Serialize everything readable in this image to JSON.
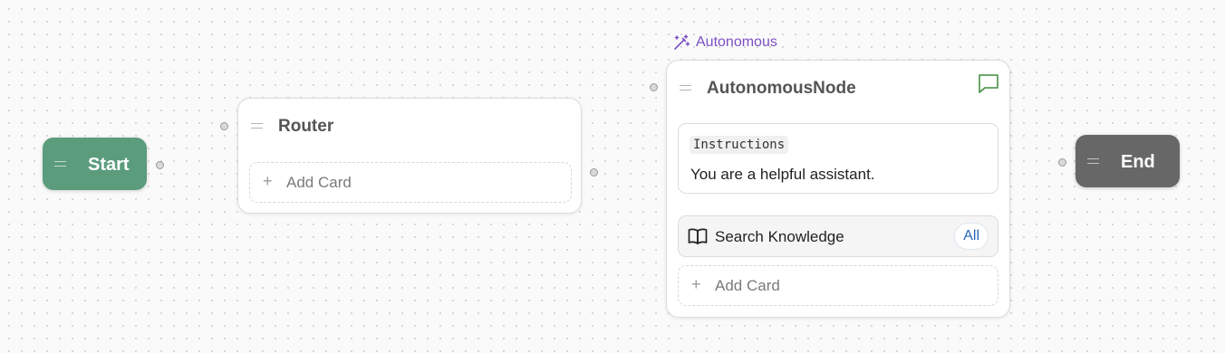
{
  "nodes": {
    "start": {
      "title": "Start"
    },
    "router": {
      "title": "Router",
      "add_card_label": "Add Card"
    },
    "autonomous": {
      "badge": "Autonomous",
      "title": "AutonomousNode",
      "instructions_tag": "Instructions",
      "instructions_text": "You are a helpful assistant.",
      "tool_label": "Search Knowledge",
      "tool_scope": "All",
      "add_card_label": "Add Card"
    },
    "end": {
      "title": "End"
    }
  },
  "icons": {
    "badge": "magic-wand-icon",
    "chat": "chat-icon",
    "tool": "book-icon",
    "add": "plus-icon",
    "drag": "drag-handle-icon"
  },
  "colors": {
    "start": "#5a9c7c",
    "end": "#676767",
    "autonomous_badge": "#7b4fc4",
    "chat_icon": "#5a9c5a",
    "scope_pill": "#2a67b8"
  }
}
